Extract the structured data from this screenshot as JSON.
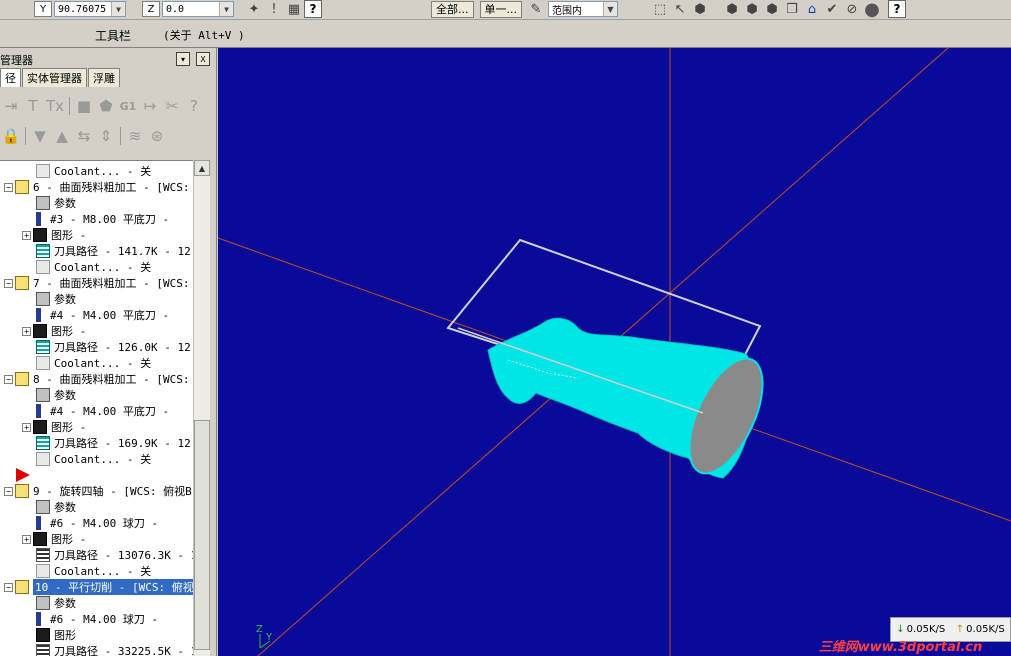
{
  "toolbar": {
    "y_label": "Y",
    "y_value": "90.76075",
    "z_label": "Z",
    "z_value": "0.0",
    "all_button": "全部...",
    "single_button": "单一...",
    "range_select": "范围内",
    "help_label": "?"
  },
  "bar2": {
    "toolbar_label": "工具栏",
    "shortcut_hint": "(关于 Alt+V )"
  },
  "panel": {
    "title": "管理器",
    "tabs": [
      "径",
      "实体管理器",
      "浮雕"
    ],
    "close_label": "X",
    "menu_label": "▾"
  },
  "tree": [
    {
      "icon": "cool",
      "text": "Coolant... - 关",
      "level": 2
    },
    {
      "icon": "folder",
      "text": "6 - 曲面残料粗加工 - [WCS:",
      "level": 1
    },
    {
      "icon": "param",
      "text": "参数",
      "level": 2
    },
    {
      "icon": "tool",
      "text": "#3 - M8.00 平底刀 -",
      "level": 2
    },
    {
      "icon": "geom",
      "text": "图形 -",
      "level": 2,
      "expand": true
    },
    {
      "icon": "path",
      "text": "刀具路径 - 141.7K - 12.",
      "level": 2
    },
    {
      "icon": "cool",
      "text": "Coolant... - 关",
      "level": 2
    },
    {
      "icon": "folder",
      "text": "7 - 曲面残料粗加工 - [WCS:",
      "level": 1
    },
    {
      "icon": "param",
      "text": "参数",
      "level": 2
    },
    {
      "icon": "tool",
      "text": "#4 - M4.00 平底刀 -",
      "level": 2
    },
    {
      "icon": "geom",
      "text": "图形 -",
      "level": 2,
      "expand": true
    },
    {
      "icon": "path",
      "text": "刀具路径 - 126.0K - 12.",
      "level": 2
    },
    {
      "icon": "cool",
      "text": "Coolant... - 关",
      "level": 2
    },
    {
      "icon": "folder",
      "text": "8 - 曲面残料粗加工 - [WCS:",
      "level": 1
    },
    {
      "icon": "param",
      "text": "参数",
      "level": 2
    },
    {
      "icon": "tool",
      "text": "#4 - M4.00 平底刀 -",
      "level": 2
    },
    {
      "icon": "geom",
      "text": "图形 -",
      "level": 2,
      "expand": true
    },
    {
      "icon": "path",
      "text": "刀具路径 - 169.9K - 12.",
      "level": 2
    },
    {
      "icon": "cool",
      "text": "Coolant... - 关",
      "level": 2
    },
    {
      "icon": "arrow",
      "text": "",
      "level": 0
    },
    {
      "icon": "folder",
      "text": "9 - 旋转四轴 - [WCS: 俯视B",
      "level": 1
    },
    {
      "icon": "param",
      "text": "参数",
      "level": 2
    },
    {
      "icon": "tool",
      "text": "#6 - M4.00 球刀 -",
      "level": 2
    },
    {
      "icon": "geom",
      "text": "图形 -",
      "level": 2,
      "expand": true
    },
    {
      "icon": "path2",
      "text": "刀具路径 - 13076.3K - 1",
      "level": 2
    },
    {
      "icon": "cool",
      "text": "Coolant... - 关",
      "level": 2
    },
    {
      "icon": "folder",
      "text": "10 - 平行切削 - [WCS: 俯视",
      "level": 1,
      "selected": true
    },
    {
      "icon": "param",
      "text": "参数",
      "level": 2
    },
    {
      "icon": "tool",
      "text": "#6 - M4.00 球刀 -",
      "level": 2
    },
    {
      "icon": "geom",
      "text": "图形",
      "level": 2
    },
    {
      "icon": "path2",
      "text": "刀具路径 - 33225.5K - 1",
      "level": 2
    }
  ],
  "viewport": {
    "axis_z": "Z",
    "axis_y": "Y"
  },
  "network": {
    "download": "0.05K/S",
    "upload": "0.05K/S"
  },
  "watermark": "三维网www.3dportal.cn",
  "colors": {
    "viewport_bg": "#0a0a9a",
    "model": "#00e5e5",
    "selection": "#316ac5"
  }
}
